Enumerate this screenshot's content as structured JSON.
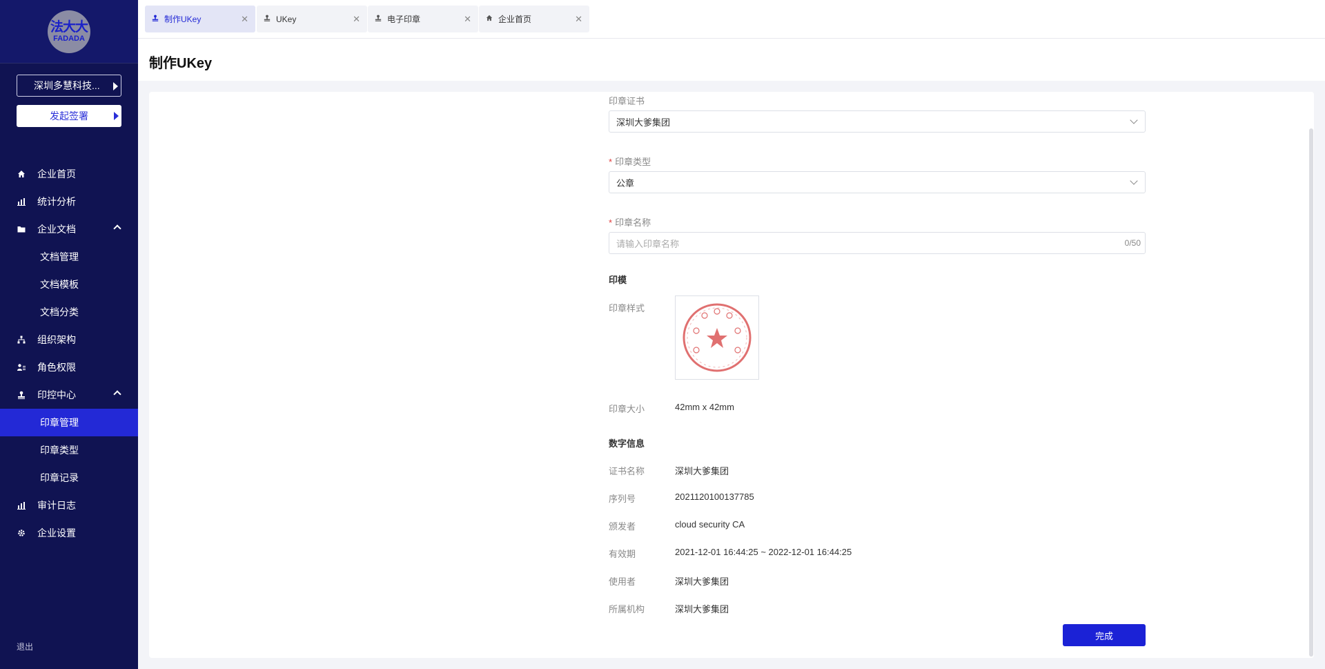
{
  "logo": {
    "cn": "法大大",
    "en": "FADADA"
  },
  "sidebar": {
    "company": "深圳多慧科技...",
    "sign_button": "发起签署",
    "nav": [
      {
        "label": "企业首页",
        "icon": "home-icon"
      },
      {
        "label": "统计分析",
        "icon": "bar-chart-icon"
      },
      {
        "label": "企业文档",
        "icon": "folder-icon",
        "expanded": true,
        "children": [
          "文档管理",
          "文档模板",
          "文档分类"
        ]
      },
      {
        "label": "组织架构",
        "icon": "org-chart-icon"
      },
      {
        "label": "角色权限",
        "icon": "user-role-icon"
      },
      {
        "label": "印控中心",
        "icon": "stamp-icon",
        "expanded": true,
        "children": [
          "印章管理",
          "印章类型",
          "印章记录"
        ],
        "active_child": "印章管理"
      },
      {
        "label": "审计日志",
        "icon": "bar-chart-icon"
      },
      {
        "label": "企业设置",
        "icon": "gear-icon"
      }
    ],
    "logout": "退出"
  },
  "tabs": [
    {
      "label": "制作UKey",
      "icon": "stamp-icon",
      "active": true
    },
    {
      "label": "UKey",
      "icon": "stamp-icon",
      "active": false
    },
    {
      "label": "电子印章",
      "icon": "stamp-icon",
      "active": false
    },
    {
      "label": "企业首页",
      "icon": "home-icon",
      "active": false
    }
  ],
  "page": {
    "title": "制作UKey"
  },
  "form": {
    "cert_label": "印章证书",
    "cert_value": "深圳大爹集团",
    "type_label": "印章类型",
    "type_value": "公章",
    "name_label": "印章名称",
    "name_placeholder": "请输入印章名称",
    "name_count": "0/50",
    "mold_section": "印模",
    "style_label": "印章样式",
    "size_label": "印章大小",
    "size_value": "42mm x 42mm",
    "digital_section": "数字信息",
    "cert_name_label": "证书名称",
    "cert_name_value": "深圳大爹集团",
    "serial_label": "序列号",
    "serial_value": "2021120100137785",
    "issuer_label": "颁发者",
    "issuer_value": "cloud security CA",
    "validity_label": "有效期",
    "validity_value": "2021-12-01 16:44:25 ~ 2022-12-01 16:44:25",
    "user_label": "使用者",
    "user_value": "深圳大爹集团",
    "org_label": "所属机构",
    "org_value": "深圳大爹集团",
    "done_button": "完成"
  },
  "colors": {
    "sidebar_bg": "#101352",
    "accent": "#1b22d6",
    "seal_red": "#e07070"
  }
}
